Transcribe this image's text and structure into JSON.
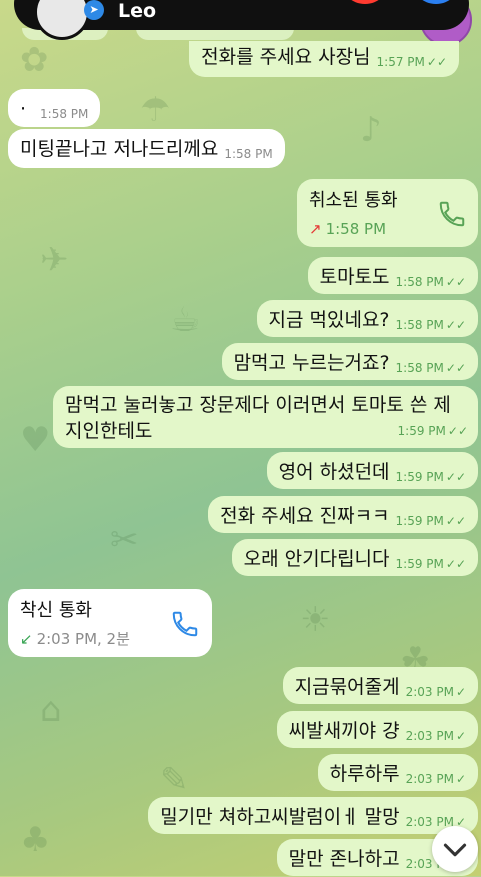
{
  "call_banner": {
    "caller_name": "Leo",
    "badge_icon": "telegram-icon"
  },
  "colors": {
    "outgoing_bubble": "#e3f7c9",
    "incoming_bubble": "#ffffff",
    "accent_green": "#58a356",
    "missed_red": "#e53935",
    "decline_red": "#ff3b30",
    "accept_blue": "#2b7ff0"
  },
  "messages": [
    {
      "text": "전화를 주세요 사장님",
      "time": "1:57 PM",
      "ticks": "✓✓"
    },
    {
      "text": "·",
      "time": "1:58 PM"
    },
    {
      "text": "미팅끝나고 저나드리께요",
      "time": "1:58 PM"
    },
    {
      "title": "취소된 통화",
      "meta": "1:58 PM"
    },
    {
      "text": "토마토도",
      "time": "1:58 PM",
      "ticks": "✓✓"
    },
    {
      "text": "지금 먹있네요?",
      "time": "1:58 PM",
      "ticks": "✓✓"
    },
    {
      "text": "맘먹고 누르는거죠?",
      "time": "1:58 PM",
      "ticks": "✓✓"
    },
    {
      "text": "맘먹고 눌러놓고 장문제다 이러면서 토마토 쓴 제지인한테도",
      "time": "1:59 PM",
      "ticks": "✓✓"
    },
    {
      "text": "영어 하셨던데",
      "time": "1:59 PM",
      "ticks": "✓✓"
    },
    {
      "text": "전화 주세요 진짜ㅋㅋ",
      "time": "1:59 PM",
      "ticks": "✓✓"
    },
    {
      "text": "오래 안기다립니다",
      "time": "1:59 PM",
      "ticks": "✓✓"
    },
    {
      "title": "착신 통화",
      "meta": "2:03 PM, 2분"
    },
    {
      "text": "지금묶어줄게",
      "time": "2:03 PM",
      "ticks": "✓"
    },
    {
      "text": "씨발새끼야 걍",
      "time": "2:03 PM",
      "ticks": "✓"
    },
    {
      "text": "하루하루",
      "time": "2:03 PM",
      "ticks": "✓"
    },
    {
      "text": "밀기만 쳐하고씨발럼이ㅔ 말망",
      "time": "2:03 PM",
      "ticks": "✓"
    },
    {
      "text": "말만 존나하고",
      "time": "2:03 PM",
      "ticks": "✓"
    }
  ]
}
